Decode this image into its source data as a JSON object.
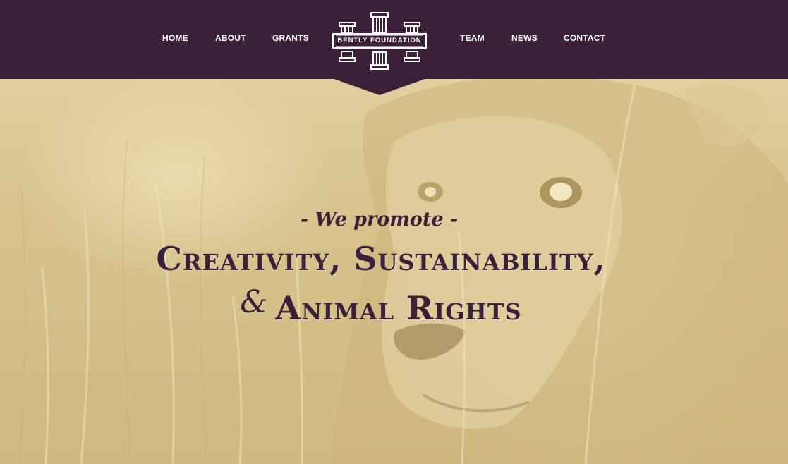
{
  "nav": {
    "left": [
      "HOME",
      "ABOUT",
      "GRANTS"
    ],
    "right": [
      "TEAM",
      "NEWS",
      "CONTACT"
    ]
  },
  "logo": {
    "text": "BENTLY FOUNDATION"
  },
  "hero": {
    "tagline": "- We promote -",
    "line1": "Creativity, Sustainability,",
    "line2_amp": "&",
    "line2": "Animal Rights",
    "image": "lion-in-grass"
  },
  "colors": {
    "bar": "#3b2039",
    "text": "#3b2039",
    "tint": "#d9c48f"
  }
}
